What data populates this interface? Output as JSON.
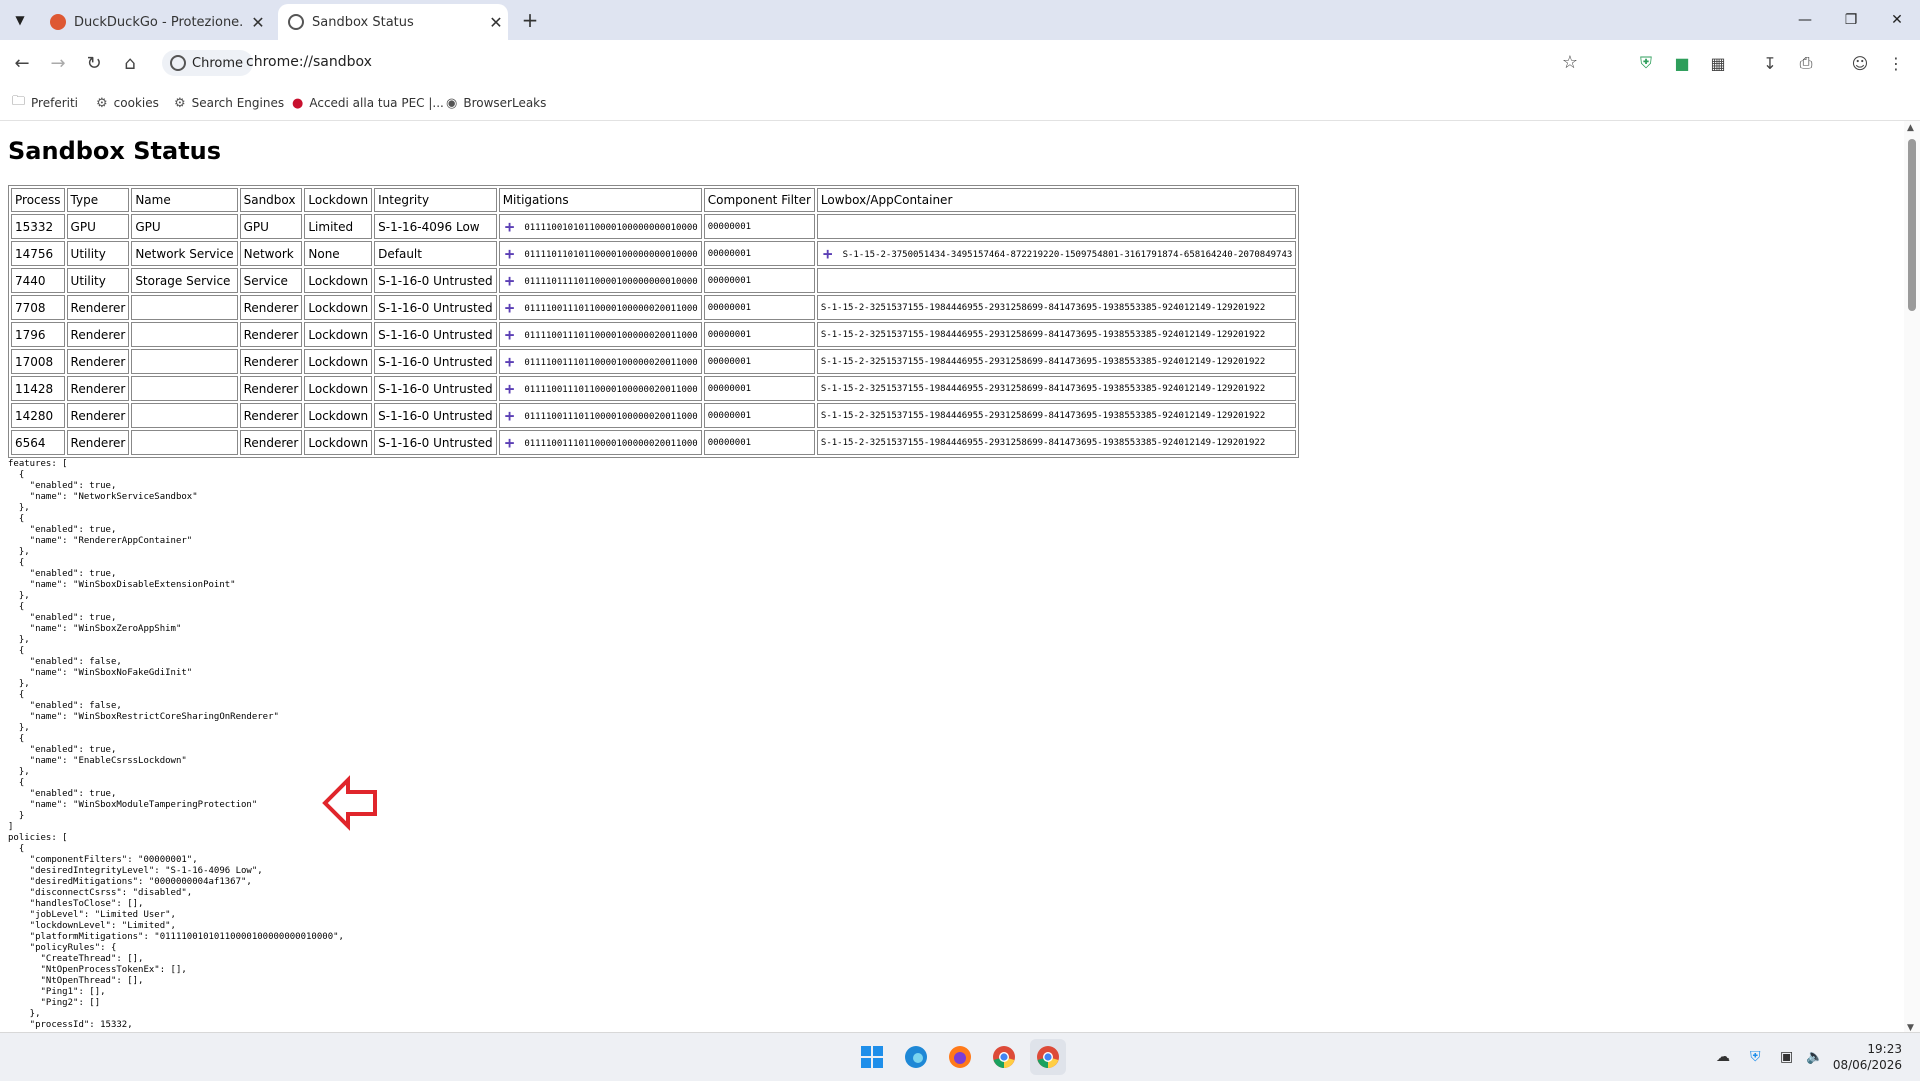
{
  "browser": {
    "tabs": [
      {
        "title": "DuckDuckGo - Protezione. Priva",
        "active": false
      },
      {
        "title": "Sandbox Status",
        "active": true
      }
    ],
    "new_tab": "+",
    "omnibox": {
      "chip_label": "Chrome",
      "url": "chrome://sandbox"
    },
    "bookmarks": [
      "Preferiti",
      "cookies",
      "Search Engines",
      "Accedi alla tua PEC |...",
      "BrowserLeaks"
    ]
  },
  "page": {
    "title": "Sandbox Status",
    "table": {
      "headers": [
        "Process",
        "Type",
        "Name",
        "Sandbox",
        "Lockdown",
        "Integrity",
        "Mitigations",
        "Component Filter",
        "Lowbox/AppContainer"
      ],
      "rows": [
        [
          "15332",
          "GPU",
          "GPU",
          "GPU",
          "Limited",
          "S-1-16-4096 Low",
          "01111001010110000100000000010000",
          "00000001",
          ""
        ],
        [
          "14756",
          "Utility",
          "Network Service",
          "Network",
          "None",
          "Default",
          "01111011010110000100000000010000",
          "00000001",
          "S-1-15-2-3750051434-3495157464-872219220-1509754801-3161791874-658164240-2070849743"
        ],
        [
          "7440",
          "Utility",
          "Storage Service",
          "Service",
          "Lockdown",
          "S-1-16-0 Untrusted",
          "01111011110110000100000000010000",
          "00000001",
          ""
        ],
        [
          "7708",
          "Renderer",
          "",
          "Renderer",
          "Lockdown",
          "S-1-16-0 Untrusted",
          "01111001110110000100000020011000",
          "00000001",
          "S-1-15-2-3251537155-1984446955-2931258699-841473695-1938553385-924012149-129201922"
        ],
        [
          "1796",
          "Renderer",
          "",
          "Renderer",
          "Lockdown",
          "S-1-16-0 Untrusted",
          "01111001110110000100000020011000",
          "00000001",
          "S-1-15-2-3251537155-1984446955-2931258699-841473695-1938553385-924012149-129201922"
        ],
        [
          "17008",
          "Renderer",
          "",
          "Renderer",
          "Lockdown",
          "S-1-16-0 Untrusted",
          "01111001110110000100000020011000",
          "00000001",
          "S-1-15-2-3251537155-1984446955-2931258699-841473695-1938553385-924012149-129201922"
        ],
        [
          "11428",
          "Renderer",
          "",
          "Renderer",
          "Lockdown",
          "S-1-16-0 Untrusted",
          "01111001110110000100000020011000",
          "00000001",
          "S-1-15-2-3251537155-1984446955-2931258699-841473695-1938553385-924012149-129201922"
        ],
        [
          "14280",
          "Renderer",
          "",
          "Renderer",
          "Lockdown",
          "S-1-16-0 Untrusted",
          "01111001110110000100000020011000",
          "00000001",
          "S-1-15-2-3251537155-1984446955-2931258699-841473695-1938553385-924012149-129201922"
        ],
        [
          "6564",
          "Renderer",
          "",
          "Renderer",
          "Lockdown",
          "S-1-16-0 Untrusted",
          "01111001110110000100000020011000",
          "00000001",
          "S-1-15-2-3251537155-1984446955-2931258699-841473695-1938553385-924012149-129201922"
        ]
      ]
    },
    "json_lines": [
      "features: [",
      "  {",
      "    \"enabled\": true,",
      "    \"name\": \"NetworkServiceSandbox\"",
      "  },",
      "  {",
      "    \"enabled\": true,",
      "    \"name\": \"RendererAppContainer\"",
      "  },",
      "  {",
      "    \"enabled\": true,",
      "    \"name\": \"WinSboxDisableExtensionPoint\"",
      "  },",
      "  {",
      "    \"enabled\": true,",
      "    \"name\": \"WinSboxZeroAppShim\"",
      "  },",
      "  {",
      "    \"enabled\": false,",
      "    \"name\": \"WinSboxNoFakeGdiInit\"",
      "  },",
      "  {",
      "    \"enabled\": false,",
      "    \"name\": \"WinSboxRestrictCoreSharingOnRenderer\"",
      "  },",
      "  {",
      "    \"enabled\": true,",
      "    \"name\": \"EnableCsrssLockdown\"",
      "  },",
      "  {",
      "    \"enabled\": true,",
      "    \"name\": \"WinSboxModuleTamperingProtection\"",
      "  }",
      "]",
      "policies: [",
      "  {",
      "    \"componentFilters\": \"00000001\",",
      "    \"desiredIntegrityLevel\": \"S-1-16-4096 Low\",",
      "    \"desiredMitigations\": \"0000000004af1367\",",
      "    \"disconnectCsrss\": \"disabled\",",
      "    \"handlesToClose\": [],",
      "    \"jobLevel\": \"Limited User\",",
      "    \"lockdownLevel\": \"Limited\",",
      "    \"platformMitigations\": \"01111001010110000100000000010000\",",
      "    \"policyRules\": {",
      "      \"CreateThread\": [],",
      "      \"NtOpenProcessTokenEx\": [],",
      "      \"NtOpenThread\": [],",
      "      \"Ping1\": [],",
      "      \"Ping2\": []",
      "    },",
      "    \"processId\": 15332,"
    ]
  },
  "taskbar": {
    "apps": [
      "windows-start",
      "edge",
      "firefox",
      "chrome",
      "chrome"
    ],
    "clock_time": "19:23",
    "clock_date": "08/06/2026"
  },
  "colors": {
    "accent": "#5b3fb5",
    "tabstrip": "#dfe4f1",
    "arrow": "#e0252b"
  }
}
